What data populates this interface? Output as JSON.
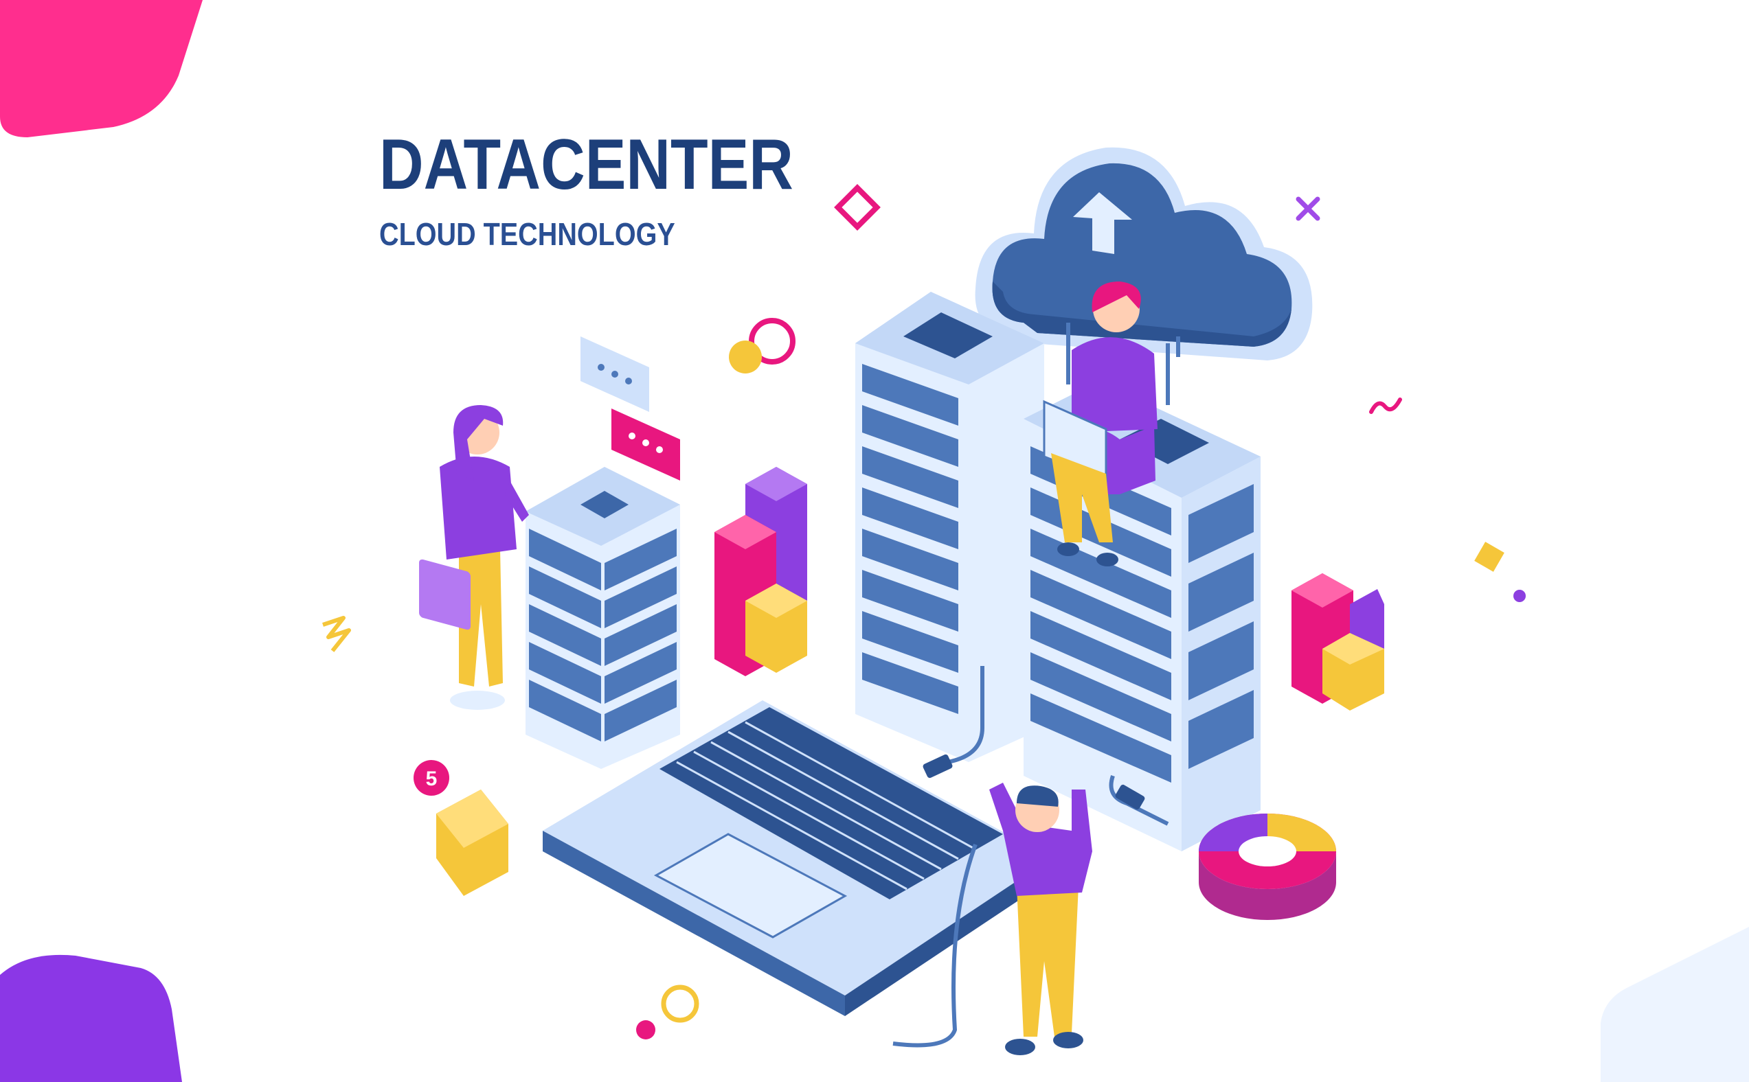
{
  "header": {
    "title": "DATACENTER",
    "subtitle": "CLOUD TECHNOLOGY"
  },
  "mail": {
    "badge_count": "5"
  },
  "colors": {
    "navy": "#1d3f7a",
    "server_blue": "#4d78ba",
    "server_light": "#e3efff",
    "cloud_blue": "#3d67a8",
    "magenta": "#e8177f",
    "purple": "#8c3fe0",
    "yellow": "#f5c63a",
    "pink_blob": "#ff2e8e",
    "violet_blob": "#8b37e6"
  },
  "icons": [
    "cloud-upload-icon",
    "server-rack-icon",
    "laptop-icon",
    "bar-chart-icon",
    "pie-chart-icon",
    "chat-bubble-icon",
    "mail-icon"
  ]
}
